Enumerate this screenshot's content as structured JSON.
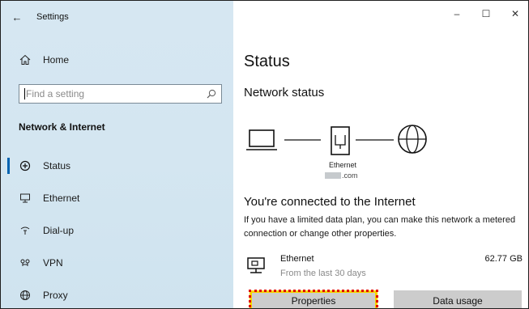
{
  "window": {
    "title": "Settings"
  },
  "sidebar": {
    "home_label": "Home",
    "search_placeholder": "Find a setting",
    "section_title": "Network & Internet",
    "items": [
      {
        "label": "Status",
        "icon": "status-icon",
        "selected": true
      },
      {
        "label": "Ethernet",
        "icon": "ethernet-icon",
        "selected": false
      },
      {
        "label": "Dial-up",
        "icon": "dialup-icon",
        "selected": false
      },
      {
        "label": "VPN",
        "icon": "vpn-icon",
        "selected": false
      },
      {
        "label": "Proxy",
        "icon": "proxy-icon",
        "selected": false
      }
    ]
  },
  "main": {
    "page_title": "Status",
    "network_status_heading": "Network status",
    "diagram": {
      "adapter_label": "Ethernet",
      "domain_suffix": ".com"
    },
    "connected_heading": "You're connected to the Internet",
    "description": "If you have a limited data plan, you can make this network a metered connection or change other properties.",
    "connection": {
      "name": "Ethernet",
      "subtitle": "From the last 30 days",
      "usage": "62.77 GB"
    },
    "buttons": {
      "properties": "Properties",
      "data_usage": "Data usage"
    }
  },
  "colors": {
    "sidebar_bg": "#d4e6f1",
    "accent": "#0063b1",
    "button_bg": "#cccccc",
    "highlight_outline": "#e00000"
  }
}
